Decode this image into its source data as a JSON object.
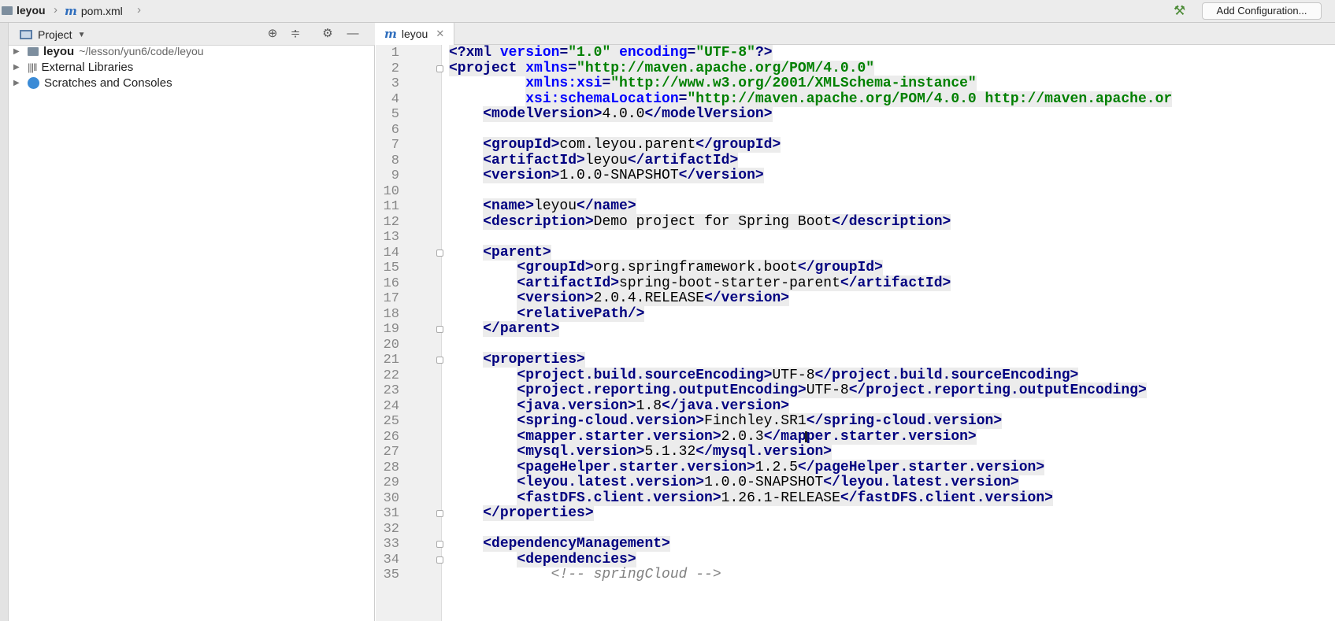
{
  "navbar": {
    "project": "leyou",
    "file": "pom.xml",
    "add_configuration": "Add Configuration..."
  },
  "project_panel": {
    "title": "Project",
    "tree": [
      {
        "label": "leyou",
        "path": "~/lesson/yun6/code/leyou"
      },
      {
        "label": "External Libraries"
      },
      {
        "label": "Scratches and Consoles"
      }
    ]
  },
  "editor": {
    "tab": "leyou",
    "lines": [
      {
        "n": "1",
        "segs": [
          [
            "tag",
            "<?xml "
          ],
          [
            "attr",
            "version"
          ],
          [
            "tag",
            "="
          ],
          [
            "str",
            "\"1.0\""
          ],
          [
            "tag",
            " "
          ],
          [
            "attr",
            "encoding"
          ],
          [
            "tag",
            "="
          ],
          [
            "str",
            "\"UTF-8\""
          ],
          [
            "tag",
            "?>"
          ]
        ]
      },
      {
        "n": "2",
        "segs": [
          [
            "tag",
            "<project "
          ],
          [
            "attr",
            "xmlns"
          ],
          [
            "tag",
            "="
          ],
          [
            "str",
            "\"http://maven.apache.org/POM/4.0.0\""
          ]
        ]
      },
      {
        "n": "3",
        "segs": [
          [
            "txt",
            "         "
          ],
          [
            "attr",
            "xmlns:xsi"
          ],
          [
            "tag",
            "="
          ],
          [
            "str",
            "\"http://www.w3.org/2001/XMLSchema-instance\""
          ]
        ]
      },
      {
        "n": "4",
        "segs": [
          [
            "txt",
            "         "
          ],
          [
            "attr",
            "xsi:schemaLocation"
          ],
          [
            "tag",
            "="
          ],
          [
            "str",
            "\"http://maven.apache.org/POM/4.0.0 http://maven.apache.or"
          ]
        ]
      },
      {
        "n": "5",
        "segs": [
          [
            "txt",
            "    "
          ],
          [
            "tag",
            "<modelVersion>"
          ],
          [
            "txt",
            "4.0.0"
          ],
          [
            "tag",
            "</modelVersion>"
          ]
        ]
      },
      {
        "n": "6",
        "segs": []
      },
      {
        "n": "7",
        "segs": [
          [
            "txt",
            "    "
          ],
          [
            "tag",
            "<groupId>"
          ],
          [
            "txt",
            "com.leyou.parent"
          ],
          [
            "tag",
            "</groupId>"
          ]
        ]
      },
      {
        "n": "8",
        "segs": [
          [
            "txt",
            "    "
          ],
          [
            "tag",
            "<artifactId>"
          ],
          [
            "txt",
            "leyou"
          ],
          [
            "tag",
            "</artifactId>"
          ]
        ]
      },
      {
        "n": "9",
        "segs": [
          [
            "txt",
            "    "
          ],
          [
            "tag",
            "<version>"
          ],
          [
            "txt",
            "1.0.0-SNAPSHOT"
          ],
          [
            "tag",
            "</version>"
          ]
        ]
      },
      {
        "n": "10",
        "segs": []
      },
      {
        "n": "11",
        "segs": [
          [
            "txt",
            "    "
          ],
          [
            "tag",
            "<name>"
          ],
          [
            "txt",
            "leyou"
          ],
          [
            "tag",
            "</name>"
          ]
        ]
      },
      {
        "n": "12",
        "segs": [
          [
            "txt",
            "    "
          ],
          [
            "tag",
            "<description>"
          ],
          [
            "txt",
            "Demo project for Spring Boot"
          ],
          [
            "tag",
            "</description>"
          ]
        ]
      },
      {
        "n": "13",
        "segs": []
      },
      {
        "n": "14",
        "segs": [
          [
            "txt",
            "    "
          ],
          [
            "tag",
            "<parent>"
          ]
        ]
      },
      {
        "n": "15",
        "segs": [
          [
            "txt",
            "        "
          ],
          [
            "tag",
            "<groupId>"
          ],
          [
            "txt",
            "org.springframework.boot"
          ],
          [
            "tag",
            "</groupId>"
          ]
        ]
      },
      {
        "n": "16",
        "segs": [
          [
            "txt",
            "        "
          ],
          [
            "tag",
            "<artifactId>"
          ],
          [
            "txt",
            "spring-boot-starter-parent"
          ],
          [
            "tag",
            "</artifactId>"
          ]
        ]
      },
      {
        "n": "17",
        "segs": [
          [
            "txt",
            "        "
          ],
          [
            "tag",
            "<version>"
          ],
          [
            "txt",
            "2.0.4.RELEASE"
          ],
          [
            "tag",
            "</version>"
          ]
        ]
      },
      {
        "n": "18",
        "segs": [
          [
            "txt",
            "        "
          ],
          [
            "tag",
            "<relativePath/>"
          ]
        ]
      },
      {
        "n": "19",
        "segs": [
          [
            "txt",
            "    "
          ],
          [
            "tag",
            "</parent>"
          ]
        ]
      },
      {
        "n": "20",
        "segs": []
      },
      {
        "n": "21",
        "segs": [
          [
            "txt",
            "    "
          ],
          [
            "tag",
            "<properties>"
          ]
        ]
      },
      {
        "n": "22",
        "segs": [
          [
            "txt",
            "        "
          ],
          [
            "tag",
            "<project.build.sourceEncoding>"
          ],
          [
            "txt",
            "UTF-8"
          ],
          [
            "tag",
            "</project.build.sourceEncoding>"
          ]
        ]
      },
      {
        "n": "23",
        "segs": [
          [
            "txt",
            "        "
          ],
          [
            "tag",
            "<project.reporting.outputEncoding>"
          ],
          [
            "txt",
            "UTF-8"
          ],
          [
            "tag",
            "</project.reporting.outputEncoding>"
          ]
        ]
      },
      {
        "n": "24",
        "segs": [
          [
            "txt",
            "        "
          ],
          [
            "tag",
            "<java.version>"
          ],
          [
            "txt",
            "1.8"
          ],
          [
            "tag",
            "</java.version>"
          ]
        ]
      },
      {
        "n": "25",
        "segs": [
          [
            "txt",
            "        "
          ],
          [
            "tag",
            "<spring-cloud.version>"
          ],
          [
            "txt",
            "Finchley.SR1"
          ],
          [
            "tag",
            "</spring-cloud.version>"
          ]
        ]
      },
      {
        "n": "26",
        "segs": [
          [
            "txt",
            "        "
          ],
          [
            "tag",
            "<mapper.starter.version>"
          ],
          [
            "txt",
            "2.0.3"
          ],
          [
            "tag",
            "</mapper.starter.version>"
          ]
        ]
      },
      {
        "n": "27",
        "segs": [
          [
            "txt",
            "        "
          ],
          [
            "tag",
            "<mysql.version>"
          ],
          [
            "txt",
            "5.1.32"
          ],
          [
            "tag",
            "</mysql.version>"
          ]
        ]
      },
      {
        "n": "28",
        "segs": [
          [
            "txt",
            "        "
          ],
          [
            "tag",
            "<pageHelper.starter.version>"
          ],
          [
            "txt",
            "1.2.5"
          ],
          [
            "tag",
            "</pageHelper.starter.version>"
          ]
        ]
      },
      {
        "n": "29",
        "segs": [
          [
            "txt",
            "        "
          ],
          [
            "tag",
            "<leyou.latest.version>"
          ],
          [
            "txt",
            "1.0.0-SNAPSHOT"
          ],
          [
            "tag",
            "</leyou.latest.version>"
          ]
        ]
      },
      {
        "n": "30",
        "segs": [
          [
            "txt",
            "        "
          ],
          [
            "tag",
            "<fastDFS.client.version>"
          ],
          [
            "txt",
            "1.26.1-RELEASE"
          ],
          [
            "tag",
            "</fastDFS.client.version>"
          ]
        ]
      },
      {
        "n": "31",
        "segs": [
          [
            "txt",
            "    "
          ],
          [
            "tag",
            "</properties>"
          ]
        ]
      },
      {
        "n": "32",
        "segs": []
      },
      {
        "n": "33",
        "segs": [
          [
            "txt",
            "    "
          ],
          [
            "tag",
            "<dependencyManagement>"
          ]
        ]
      },
      {
        "n": "34",
        "segs": [
          [
            "txt",
            "        "
          ],
          [
            "tag",
            "<dependencies>"
          ]
        ]
      },
      {
        "n": "35",
        "segs": [
          [
            "txt",
            "            "
          ],
          [
            "cmt",
            "<!-- springCloud -->"
          ]
        ]
      }
    ]
  }
}
